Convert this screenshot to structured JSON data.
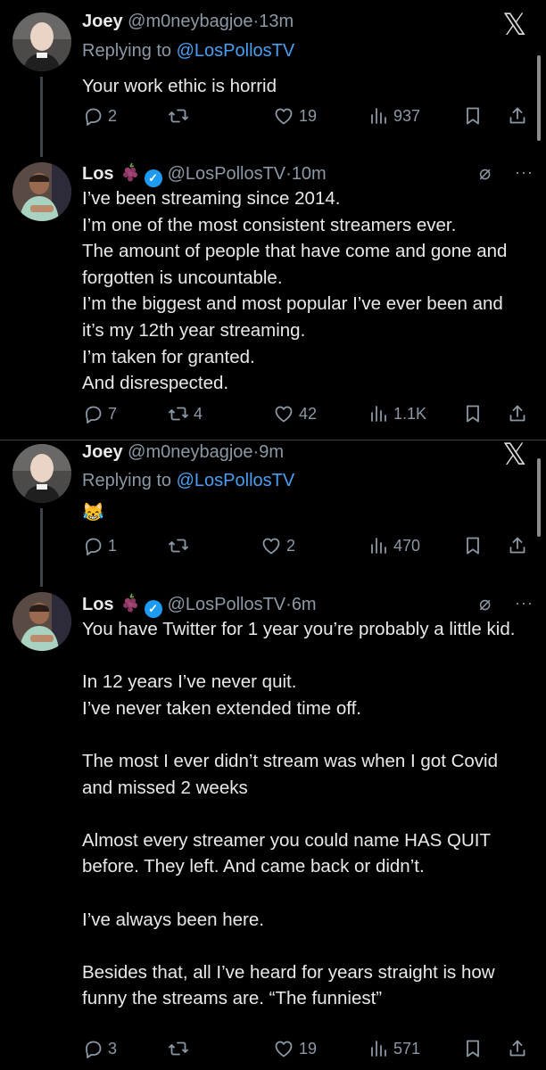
{
  "tweets": [
    {
      "name": "Joey",
      "handle": "@m0neybagjoe",
      "sep": "·",
      "time": "13m",
      "reply_prefix": "Replying to",
      "reply_to": "@LosPollosTV",
      "text": "Your work ethic is horrid",
      "replies": "2",
      "reposts": "",
      "likes": "19",
      "views": "937"
    },
    {
      "name": "Los",
      "handle": "@LosPollosTV",
      "sep": "·",
      "time": "10m",
      "text": "I’ve been streaming since 2014.\nI’m one of the most consistent streamers ever.\nThe amount of people that have come and gone and forgotten is uncountable.\nI’m the biggest and most popular I’ve ever been and it’s my 12th year streaming.\nI’m taken for granted.\nAnd disrespected.",
      "replies": "7",
      "reposts": "4",
      "likes": "42",
      "views": "1.1K"
    },
    {
      "name": "Joey",
      "handle": "@m0neybagjoe",
      "sep": "·",
      "time": "9m",
      "reply_prefix": "Replying to",
      "reply_to": "@LosPollosTV",
      "text": "😹",
      "replies": "1",
      "reposts": "",
      "likes": "2",
      "views": "470"
    },
    {
      "name": "Los",
      "handle": "@LosPollosTV",
      "sep": "·",
      "time": "6m",
      "text": "You have Twitter for 1 year you’re probably a little kid.\n\nIn 12 years I’ve never quit.\nI’ve never taken extended time off.\n\nThe most I ever didn’t stream was when I got Covid and missed 2 weeks\n\nAlmost every streamer you could name HAS QUIT before. They left. And came back or didn’t.\n\nI’ve always been here.\n\nBesides that, all I’ve heard for years straight is how funny the streams are. “The funniest”",
      "replies": "3",
      "reposts": "",
      "likes": "19",
      "views": "571"
    }
  ],
  "icons": {
    "close": "x-close-icon",
    "verified": "verified-badge-icon",
    "grape": "grape-emoji",
    "grok": "grok-icon",
    "more": "more-options-icon",
    "reply": "reply-icon",
    "repost": "repost-icon",
    "like": "like-icon",
    "views": "views-icon",
    "bookmark": "bookmark-icon",
    "share": "share-icon"
  },
  "colors": {
    "background": "#000000",
    "text": "#e7e9ea",
    "secondary": "#8b98a5",
    "link": "#4a9ff0",
    "verified": "#1d9bf0"
  }
}
